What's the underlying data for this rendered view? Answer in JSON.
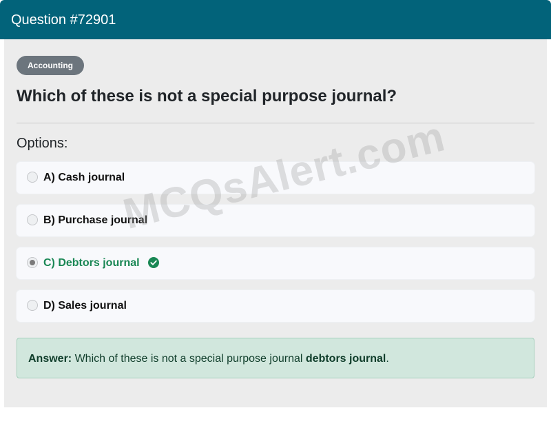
{
  "header": {
    "title": "Question #72901"
  },
  "category_badge": "Accounting",
  "question": "Which of these is not a special purpose journal?",
  "options_label": "Options:",
  "options": [
    {
      "label": "A) Cash journal",
      "selected": false,
      "correct": false
    },
    {
      "label": "B) Purchase journal",
      "selected": false,
      "correct": false
    },
    {
      "label": "C) Debtors journal",
      "selected": true,
      "correct": true
    },
    {
      "label": "D) Sales journal",
      "selected": false,
      "correct": false
    }
  ],
  "watermark": "MCQsAlert.com",
  "answer": {
    "prefix": "Answer:",
    "text": "Which of these is not a special purpose journal",
    "highlight": "debtors journal",
    "suffix": "."
  },
  "colors": {
    "header_bg": "#02637a",
    "badge_bg": "#6c757d",
    "correct": "#198754",
    "answer_bg": "#d1e7dd"
  }
}
